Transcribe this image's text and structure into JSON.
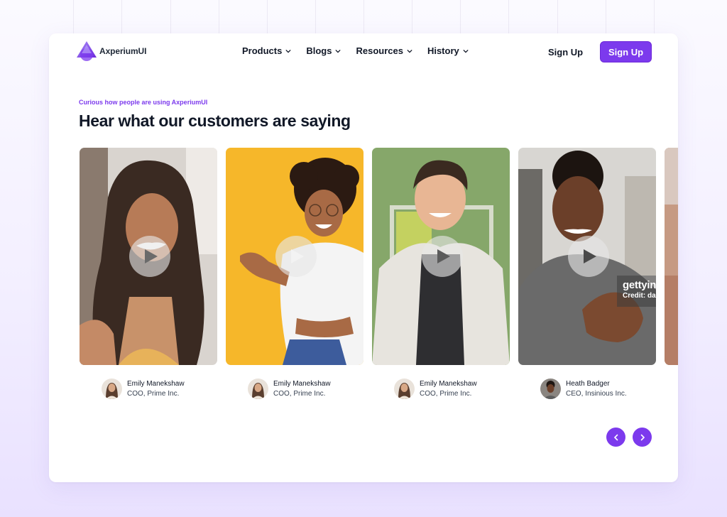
{
  "brand": {
    "name": "AxperiumUI",
    "accent": "#7c3aed"
  },
  "nav": {
    "items": [
      {
        "label": "Products",
        "icon": "chevron-down-icon"
      },
      {
        "label": "Blogs",
        "icon": "chevron-down-icon"
      },
      {
        "label": "Resources",
        "icon": "chevron-down-icon"
      },
      {
        "label": "History",
        "icon": "chevron-down-icon"
      }
    ],
    "signin_label": "Sign Up",
    "signup_label": "Sign Up"
  },
  "section": {
    "eyebrow": "Curious how people are using AxperiumUI",
    "heading": "Hear what our customers are saying"
  },
  "testimonials": [
    {
      "name": "Emily Manekshaw",
      "role": "COO, Prime Inc.",
      "photo": "woman-long-hair-video"
    },
    {
      "name": "Emily Manekshaw",
      "role": "COO, Prime Inc.",
      "photo": "woman-curly-hair-yellow-video"
    },
    {
      "name": "Emily Manekshaw",
      "role": "COO, Prime Inc.",
      "photo": "man-green-background-video"
    },
    {
      "name": "Heath Badger",
      "role": "CEO, Insinious Inc.",
      "photo": "man-waving-video"
    }
  ],
  "watermark": {
    "line1": "gettyin",
    "line2": "Credit: da"
  },
  "carousel": {
    "prev_icon": "chevron-left-icon",
    "next_icon": "chevron-right-icon"
  }
}
